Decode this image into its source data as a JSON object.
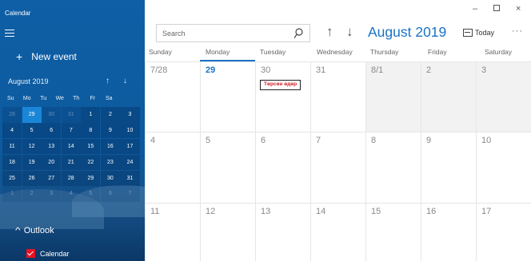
{
  "app": {
    "title": "Calendar"
  },
  "sidebar": {
    "new_event_label": "New event",
    "mini_calendar": {
      "title": "August 2019",
      "days_of_week": [
        "Su",
        "Mo",
        "Tu",
        "We",
        "Th",
        "Fr",
        "Sa"
      ],
      "weeks": [
        [
          "28",
          "29",
          "30",
          "31",
          "1",
          "2",
          "3"
        ],
        [
          "4",
          "5",
          "6",
          "7",
          "8",
          "9",
          "10"
        ],
        [
          "11",
          "12",
          "13",
          "14",
          "15",
          "16",
          "17"
        ],
        [
          "18",
          "19",
          "20",
          "21",
          "22",
          "23",
          "24"
        ],
        [
          "25",
          "26",
          "27",
          "28",
          "29",
          "30",
          "31"
        ],
        [
          "1",
          "2",
          "3",
          "4",
          "5",
          "6",
          "7"
        ]
      ],
      "selected": "29"
    },
    "accounts": [
      {
        "label": "Outlook",
        "calendars": [
          {
            "label": "Calendar",
            "checked": true,
            "color": "#e81123"
          }
        ]
      }
    ]
  },
  "toolbar": {
    "search_placeholder": "Search",
    "month_title": "August 2019",
    "today_label": "Today",
    "more_label": "···"
  },
  "window_controls": {
    "minimize": "–",
    "close": "×"
  },
  "month_view": {
    "days_of_week": [
      "Sunday",
      "Monday",
      "Tuesday",
      "Wednesday",
      "Thursday",
      "Friday",
      "Saturday"
    ],
    "selected_day_of_week": "Monday",
    "weeks": [
      [
        "7/28",
        "29",
        "30",
        "31",
        "8/1",
        "2",
        "3"
      ],
      [
        "4",
        "5",
        "6",
        "7",
        "8",
        "9",
        "10"
      ],
      [
        "11",
        "12",
        "13",
        "14",
        "15",
        "16",
        "17"
      ]
    ],
    "events": [
      {
        "day": "30",
        "label": "Төрсөн өдөр",
        "color": "#d1232a"
      }
    ],
    "today": "29"
  },
  "colors": {
    "accent": "#1a73c6",
    "sidebar_bg": "#0e5fa6"
  }
}
